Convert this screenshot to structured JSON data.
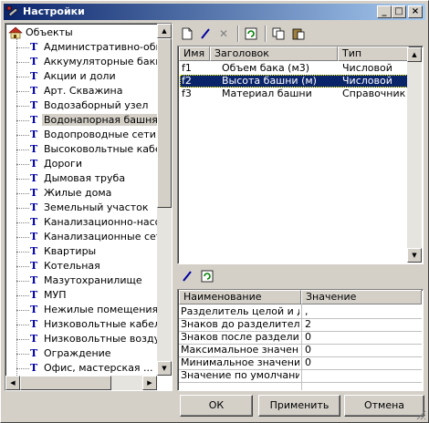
{
  "window": {
    "title": "Настройки",
    "title_icon": "settings-tools-icon",
    "controls": [
      "minimize-icon",
      "maximize-icon",
      "close-icon"
    ]
  },
  "tree": {
    "root_label": "Объекты",
    "root_icon": "house-icon",
    "item_icon_glyph": "T",
    "selected": "Водонапорная башня",
    "items": [
      "Административно-общес",
      "Аккумуляторные баки",
      "Акции и доли",
      "Арт. Скважина",
      "Водозаборный узел",
      "Водонапорная башня",
      "Водопроводные сети",
      "Высоковольтные   кабе.",
      "Дороги",
      "Дымовая труба",
      "Жилые дома",
      "Земельный участок",
      "Канализационно-насосн",
      "Канализационные сети",
      "Квартиры",
      "Котельная",
      "Мазутохранилище",
      "МУП",
      "Нежилые помещения",
      "Низковольтные   кабель",
      "Низковольтные воздуш",
      "Ограждение",
      "Офис, мастерская ..."
    ]
  },
  "toolbar1": {
    "buttons": [
      "new-document-icon",
      "edit-pencil-icon",
      "delete-x-icon",
      "refresh-icon",
      "copy-icon",
      "paste-icon"
    ]
  },
  "fields_table": {
    "columns": [
      "Имя",
      "Заголовок",
      "Тип"
    ],
    "rows": [
      {
        "name": "f1",
        "title": "Объем бака (м3)",
        "type": "Числовой",
        "selected": false
      },
      {
        "name": "f2",
        "title": "Высота башни (м)",
        "type": "Числовой",
        "selected": true
      },
      {
        "name": "f3",
        "title": "Материал башни",
        "type": "Справочник",
        "selected": false
      }
    ]
  },
  "toolbar2": {
    "buttons": [
      "edit-pencil-icon",
      "refresh-icon"
    ]
  },
  "props_table": {
    "columns": [
      "Наименование",
      "Значение"
    ],
    "rows": [
      {
        "name": "Разделитель целой и д...",
        "value": ","
      },
      {
        "name": "Знаков до разделителя",
        "value": "2"
      },
      {
        "name": "Знаков после раздели...",
        "value": "0"
      },
      {
        "name": "Максимальное значение",
        "value": "0"
      },
      {
        "name": "Минимальное значение",
        "value": "0"
      },
      {
        "name": "Значение по умолчанию",
        "value": ""
      }
    ]
  },
  "buttons": {
    "ok": "ОК",
    "apply": "Применить",
    "cancel": "Отмена"
  },
  "colors": {
    "title_start": "#0a246a",
    "title_end": "#a6caf0",
    "selection": "#0a246a",
    "tree_icon": "#0000a8",
    "face": "#d4d0c8"
  }
}
